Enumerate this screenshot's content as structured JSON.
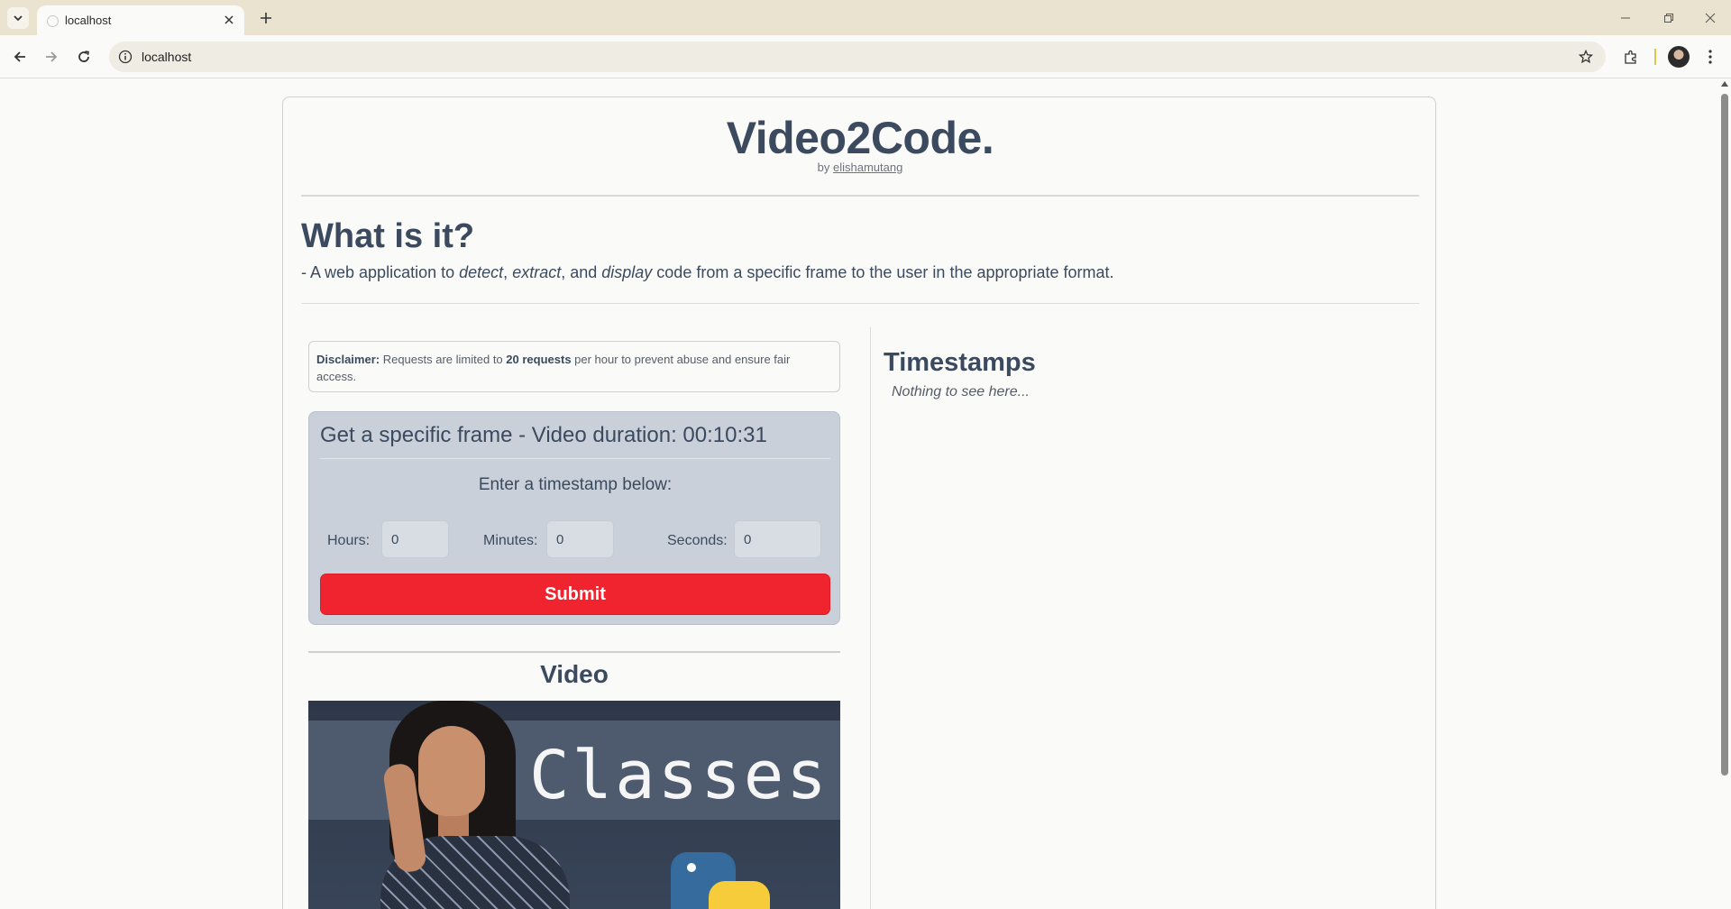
{
  "browser": {
    "tab_title": "localhost",
    "address": "localhost"
  },
  "header": {
    "title": "Video2Code.",
    "by": "by",
    "author": "elishamutang"
  },
  "about": {
    "heading": "What is it?",
    "desc_prefix": "- A web application to ",
    "detect": "detect",
    "sep1": ", ",
    "extract": "extract",
    "sep2": ", and ",
    "display": "display",
    "desc_suffix": " code from a specific frame to the user in the appropriate format."
  },
  "disclaimer": {
    "label": "Disclaimer:",
    "text1": " Requests are limited to ",
    "limit": "20 requests",
    "text2": " per hour to prevent abuse and ensure fair access."
  },
  "frame_form": {
    "title": "Get a specific frame - Video duration: 00:10:31",
    "prompt": "Enter a timestamp below:",
    "hours_label": "Hours:",
    "hours_value": "0",
    "minutes_label": "Minutes:",
    "minutes_value": "0",
    "seconds_label": "Seconds:",
    "seconds_value": "0",
    "submit_label": "Submit"
  },
  "video": {
    "heading": "Video",
    "thumbnail_text": "Classes"
  },
  "timestamps": {
    "heading": "Timestamps",
    "empty_text": "Nothing to see here..."
  },
  "colors": {
    "heading": "#3b4a5e",
    "submit": "#f0242e",
    "form_bg": "#c9d0d9"
  }
}
